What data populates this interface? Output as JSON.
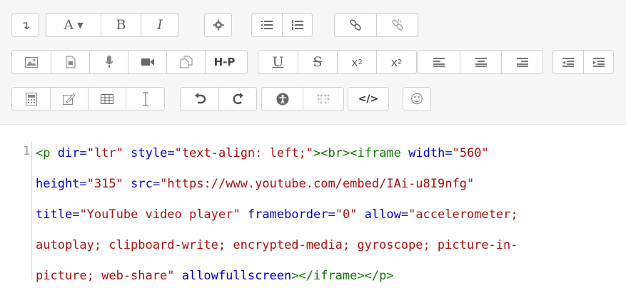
{
  "toolbar": {
    "rows": [
      [
        {
          "group": "show-more",
          "buttons": [
            {
              "name": "show-more-icon",
              "label": "↴"
            }
          ]
        },
        {
          "group": "font",
          "buttons": [
            {
              "name": "font-size-dropdown",
              "label": "A ▾"
            },
            {
              "name": "bold-button",
              "label": "B"
            },
            {
              "name": "italic-button",
              "label": "I"
            }
          ]
        },
        {
          "group": "settings",
          "buttons": [
            {
              "name": "gear-icon",
              "label": "⚙"
            }
          ]
        },
        {
          "group": "lists",
          "buttons": [
            {
              "name": "unordered-list-icon",
              "label": "☰"
            },
            {
              "name": "ordered-list-icon",
              "label": "☰"
            }
          ]
        },
        {
          "group": "links",
          "buttons": [
            {
              "name": "link-icon",
              "label": ""
            },
            {
              "name": "unlink-icon",
              "label": ""
            }
          ]
        }
      ]
    ],
    "text_buttons": {
      "font": "A",
      "bold": "B",
      "italic": "I",
      "h5p": "H-P",
      "underline": "U",
      "strike": "S",
      "subscript_base": "x",
      "subscript_digit": "2",
      "superscript_base": "x",
      "superscript_digit": "2",
      "html": "</>",
      "emoji": "☺"
    }
  },
  "code": {
    "line_number": "1",
    "lines": [
      [
        [
          "tag",
          "<p"
        ],
        [
          "txt",
          " "
        ],
        [
          "attr",
          "dir"
        ],
        [
          "txt",
          "="
        ],
        [
          "str",
          "\"ltr\""
        ],
        [
          "txt",
          " "
        ],
        [
          "attr",
          "style"
        ],
        [
          "txt",
          "="
        ],
        [
          "str",
          "\"text-align: left;\""
        ],
        [
          "tag",
          ">"
        ],
        [
          "tag",
          "<br>"
        ],
        [
          "tag",
          "<iframe"
        ],
        [
          "txt",
          " "
        ],
        [
          "attr",
          "width"
        ],
        [
          "txt",
          "="
        ],
        [
          "str",
          "\"560\""
        ]
      ],
      [
        [
          "attr",
          "height"
        ],
        [
          "txt",
          "="
        ],
        [
          "str",
          "\"315\""
        ],
        [
          "txt",
          " "
        ],
        [
          "attr",
          "src"
        ],
        [
          "txt",
          "="
        ],
        [
          "str",
          "\"https://www.youtube.com/embed/IAi-u8I9nfg\""
        ]
      ],
      [
        [
          "attr",
          "title"
        ],
        [
          "txt",
          "="
        ],
        [
          "str",
          "\"YouTube video player\""
        ],
        [
          "txt",
          " "
        ],
        [
          "attr",
          "frameborder"
        ],
        [
          "txt",
          "="
        ],
        [
          "str",
          "\"0\""
        ],
        [
          "txt",
          " "
        ],
        [
          "attr",
          "allow"
        ],
        [
          "txt",
          "="
        ],
        [
          "str",
          "\"accelerometer;"
        ]
      ],
      [
        [
          "str",
          "autoplay; clipboard-write; encrypted-media; gyroscope; picture-in-"
        ]
      ],
      [
        [
          "str",
          "picture; web-share\""
        ],
        [
          "txt",
          " "
        ],
        [
          "attr",
          "allowfullscreen"
        ],
        [
          "tag",
          ">"
        ],
        [
          "tag",
          "</iframe>"
        ],
        [
          "tag",
          "</p>"
        ]
      ]
    ]
  }
}
